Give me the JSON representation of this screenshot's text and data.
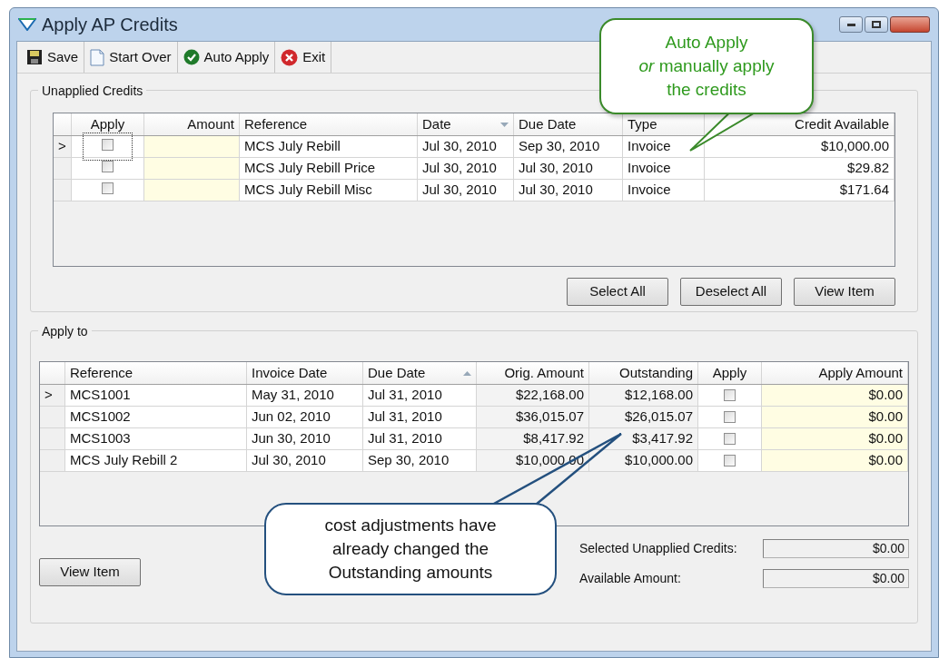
{
  "window": {
    "title": "Apply AP Credits"
  },
  "toolbar": [
    {
      "label": "Save"
    },
    {
      "label": "Start Over"
    },
    {
      "label": "Auto Apply"
    },
    {
      "label": "Exit"
    }
  ],
  "unapplied_credits": {
    "title": "Unapplied Credits",
    "columns": [
      {
        "label": "Apply",
        "sorted": false
      },
      {
        "label": "Amount",
        "sorted": false
      },
      {
        "label": "Reference",
        "sorted": false
      },
      {
        "label": "Date",
        "sorted": true,
        "descending": true
      },
      {
        "label": "Due Date",
        "sorted": false
      },
      {
        "label": "Type",
        "sorted": false
      },
      {
        "label": "Credit Available",
        "sorted": false
      }
    ],
    "rows": [
      {
        "marker": ">",
        "apply": false,
        "focused": true,
        "reference": "MCS July Rebill",
        "date": "Jul 30, 2010",
        "due_date": "Sep 30, 2010",
        "type": "Invoice",
        "credit_available": "$10,000.00"
      },
      {
        "apply": false,
        "focused": false,
        "reference": "MCS July Rebill Price",
        "date": "Jul 30, 2010",
        "due_date": "Jul 30, 2010",
        "type": "Invoice",
        "credit_available": "$29.82"
      },
      {
        "apply": false,
        "focused": false,
        "reference": "MCS July Rebill Misc",
        "date": "Jul 30, 2010",
        "due_date": "Jul 30, 2010",
        "type": "Invoice",
        "credit_available": "$171.64"
      }
    ],
    "buttons": [
      "Select All",
      "Deselect All",
      "View Item"
    ]
  },
  "apply_to": {
    "title": "Apply to",
    "columns": [
      {
        "label": "Reference",
        "sorted": false
      },
      {
        "label": "Invoice Date",
        "sorted": false
      },
      {
        "label": "Due Date",
        "sorted": true,
        "descending": false
      },
      {
        "label": "Orig. Amount",
        "sorted": false
      },
      {
        "label": "Outstanding",
        "sorted": false
      },
      {
        "label": "Apply",
        "sorted": false
      },
      {
        "label": "Apply Amount",
        "sorted": false
      }
    ],
    "rows": [
      {
        "marker": ">",
        "reference": "MCS1001",
        "invoice_date": "May 31, 2010",
        "due_date": "Jul 31, 2010",
        "orig_amount": "$22,168.00",
        "outstanding": "$12,168.00",
        "apply": false,
        "apply_amount": "$0.00"
      },
      {
        "reference": "MCS1002",
        "invoice_date": "Jun 02, 2010",
        "due_date": "Jul 31, 2010",
        "orig_amount": "$36,015.07",
        "outstanding": "$26,015.07",
        "apply": false,
        "apply_amount": "$0.00"
      },
      {
        "reference": "MCS1003",
        "invoice_date": "Jun 30, 2010",
        "due_date": "Jul 31, 2010",
        "orig_amount": "$8,417.92",
        "outstanding": "$3,417.92",
        "apply": false,
        "apply_amount": "$0.00"
      },
      {
        "reference": "MCS July Rebill 2",
        "invoice_date": "Jul 30, 2010",
        "due_date": "Sep 30, 2010",
        "orig_amount": "$10,000.00",
        "outstanding": "$10,000.00",
        "apply": false,
        "apply_amount": "$0.00"
      }
    ],
    "view_button": "View Item",
    "totals": [
      {
        "label": "Selected Unapplied Credits:",
        "value": "$0.00"
      },
      {
        "label": "Available Amount:",
        "value": "$0.00"
      }
    ]
  },
  "callouts": [
    {
      "kind": "green",
      "text": "Auto Apply\n*or* manually apply\nthe credits"
    },
    {
      "kind": "blue",
      "text": "cost adjustments have\nalready changed the\nOutstanding amounts"
    }
  ]
}
